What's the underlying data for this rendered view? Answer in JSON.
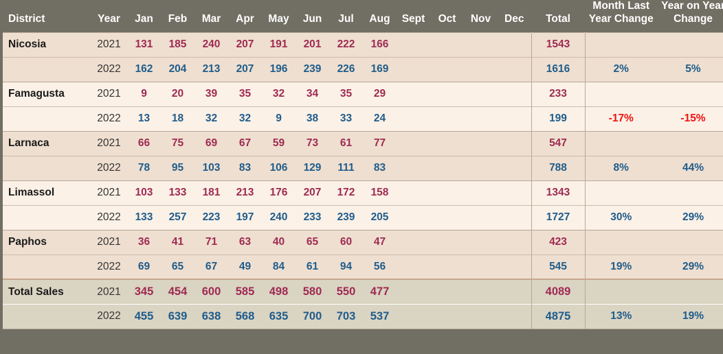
{
  "header": {
    "district": "District",
    "year": "Year",
    "months": [
      "Jan",
      "Feb",
      "Mar",
      "Apr",
      "May",
      "Jun",
      "Jul",
      "Aug",
      "Sept",
      "Oct",
      "Nov",
      "Dec"
    ],
    "total": "Total",
    "month_last_year_change": "Month Last Year Change",
    "year_on_year_change": "Year on Year Change"
  },
  "colors": {
    "header_bg": "#716E63",
    "band_a": "#EFDFD0",
    "band_b": "#FBF1E7",
    "band_total": "#DAD4C3",
    "value_2021": "#9E2A52",
    "value_2022": "#1F5C8B",
    "positive": "#1F5C8B",
    "negative": "#F01111"
  },
  "rows": [
    {
      "district": "Nicosia",
      "year": "2021",
      "months": [
        "131",
        "185",
        "240",
        "207",
        "191",
        "201",
        "222",
        "166",
        "",
        "",
        "",
        ""
      ],
      "total": "1543",
      "month_last_year_change": "",
      "year_on_year_change": ""
    },
    {
      "district": "",
      "year": "2022",
      "months": [
        "162",
        "204",
        "213",
        "207",
        "196",
        "239",
        "226",
        "169",
        "",
        "",
        "",
        ""
      ],
      "total": "1616",
      "month_last_year_change": "2%",
      "year_on_year_change": "5%"
    },
    {
      "district": "Famagusta",
      "year": "2021",
      "months": [
        "9",
        "20",
        "39",
        "35",
        "32",
        "34",
        "35",
        "29",
        "",
        "",
        "",
        ""
      ],
      "total": "233",
      "month_last_year_change": "",
      "year_on_year_change": ""
    },
    {
      "district": "",
      "year": "2022",
      "months": [
        "13",
        "18",
        "32",
        "32",
        "9",
        "38",
        "33",
        "24",
        "",
        "",
        "",
        ""
      ],
      "total": "199",
      "month_last_year_change": "-17%",
      "year_on_year_change": "-15%"
    },
    {
      "district": "Larnaca",
      "year": "2021",
      "months": [
        "66",
        "75",
        "69",
        "67",
        "59",
        "73",
        "61",
        "77",
        "",
        "",
        "",
        ""
      ],
      "total": "547",
      "month_last_year_change": "",
      "year_on_year_change": ""
    },
    {
      "district": "",
      "year": "2022",
      "months": [
        "78",
        "95",
        "103",
        "83",
        "106",
        "129",
        "111",
        "83",
        "",
        "",
        "",
        ""
      ],
      "total": "788",
      "month_last_year_change": "8%",
      "year_on_year_change": "44%"
    },
    {
      "district": "Limassol",
      "year": "2021",
      "months": [
        "103",
        "133",
        "181",
        "213",
        "176",
        "207",
        "172",
        "158",
        "",
        "",
        "",
        ""
      ],
      "total": "1343",
      "month_last_year_change": "",
      "year_on_year_change": ""
    },
    {
      "district": "",
      "year": "2022",
      "months": [
        "133",
        "257",
        "223",
        "197",
        "240",
        "233",
        "239",
        "205",
        "",
        "",
        "",
        ""
      ],
      "total": "1727",
      "month_last_year_change": "30%",
      "year_on_year_change": "29%"
    },
    {
      "district": "Paphos",
      "year": "2021",
      "months": [
        "36",
        "41",
        "71",
        "63",
        "40",
        "65",
        "60",
        "47",
        "",
        "",
        "",
        ""
      ],
      "total": "423",
      "month_last_year_change": "",
      "year_on_year_change": ""
    },
    {
      "district": "",
      "year": "2022",
      "months": [
        "69",
        "65",
        "67",
        "49",
        "84",
        "61",
        "94",
        "56",
        "",
        "",
        "",
        ""
      ],
      "total": "545",
      "month_last_year_change": "19%",
      "year_on_year_change": "29%"
    },
    {
      "district": "Total Sales",
      "year": "2021",
      "months": [
        "345",
        "454",
        "600",
        "585",
        "498",
        "580",
        "550",
        "477",
        "",
        "",
        "",
        ""
      ],
      "total": "4089",
      "month_last_year_change": "",
      "year_on_year_change": ""
    },
    {
      "district": "",
      "year": "2022",
      "months": [
        "455",
        "639",
        "638",
        "568",
        "635",
        "700",
        "703",
        "537",
        "",
        "",
        "",
        ""
      ],
      "total": "4875",
      "month_last_year_change": "13%",
      "year_on_year_change": "19%"
    }
  ]
}
